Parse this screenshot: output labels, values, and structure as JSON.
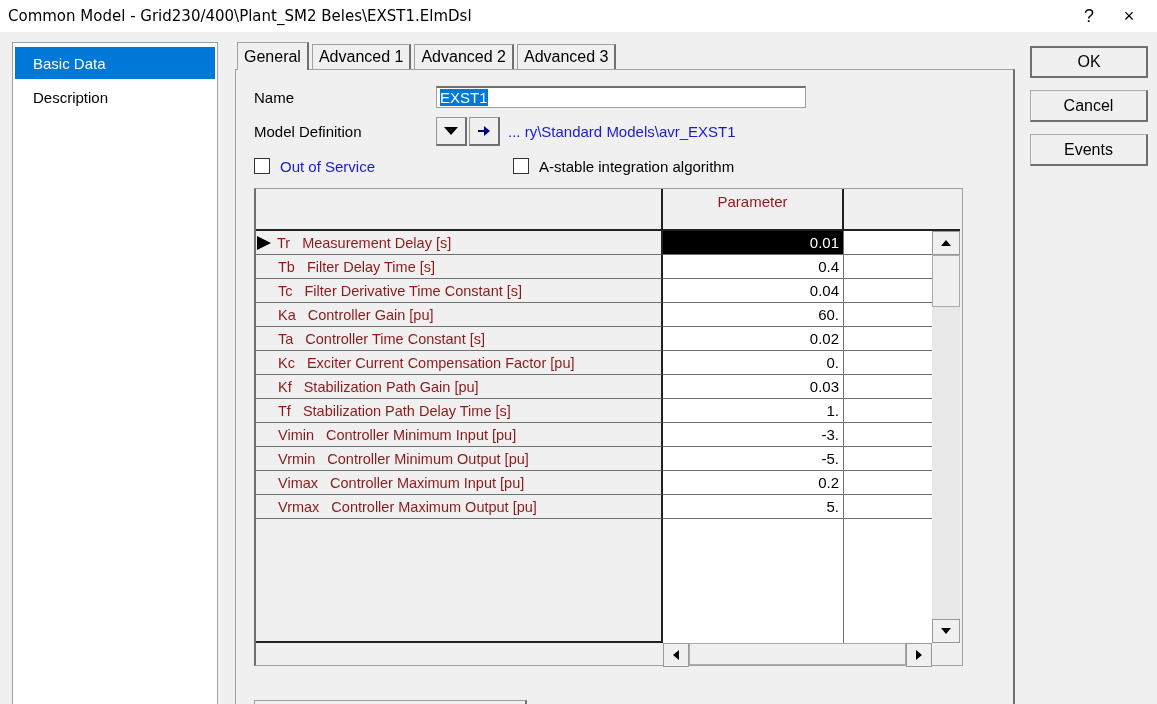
{
  "window": {
    "title": "Common Model - Grid230/400\\Plant_SM2 Beles\\EXST1.ElmDsl",
    "help": "?",
    "close": "×"
  },
  "sidebar": {
    "items": [
      {
        "label": "Basic Data",
        "selected": true
      },
      {
        "label": "Description",
        "selected": false
      }
    ]
  },
  "tabs": [
    {
      "label": "General",
      "selected": true
    },
    {
      "label": "Advanced 1",
      "selected": false
    },
    {
      "label": "Advanced 2",
      "selected": false
    },
    {
      "label": "Advanced 3",
      "selected": false
    }
  ],
  "form": {
    "name_label": "Name",
    "name_value": "EXST1",
    "model_definition_label": "Model Definition",
    "model_definition_link": "... ry\\Standard Models\\avr_EXST1",
    "checkboxes": [
      {
        "label": "Out of Service",
        "checked": false,
        "kind": "link"
      },
      {
        "label": "A-stable integration algorithm",
        "checked": false,
        "kind": "plain"
      }
    ]
  },
  "table": {
    "columns": [
      "Parameter"
    ],
    "rows": [
      {
        "symbol": "Tr",
        "description": "Measurement Delay [s]",
        "value": "0.01",
        "selected": true
      },
      {
        "symbol": "Tb",
        "description": "Filter Delay Time [s]",
        "value": "0.4",
        "selected": false
      },
      {
        "symbol": "Tc",
        "description": "Filter Derivative Time Constant [s]",
        "value": "0.04",
        "selected": false
      },
      {
        "symbol": "Ka",
        "description": "Controller Gain [pu]",
        "value": "60.",
        "selected": false
      },
      {
        "symbol": "Ta",
        "description": "Controller Time Constant [s]",
        "value": "0.02",
        "selected": false
      },
      {
        "symbol": "Kc",
        "description": "Exciter Current Compensation Factor [pu]",
        "value": "0.",
        "selected": false
      },
      {
        "symbol": "Kf",
        "description": "Stabilization Path Gain [pu]",
        "value": "0.03",
        "selected": false
      },
      {
        "symbol": "Tf",
        "description": "Stabilization Path Delay Time [s]",
        "value": "1.",
        "selected": false
      },
      {
        "symbol": "Vimin",
        "description": "Controller Minimum Input [pu]",
        "value": "-3.",
        "selected": false
      },
      {
        "symbol": "Vrmin",
        "description": "Controller Minimum Output [pu]",
        "value": "-5.",
        "selected": false
      },
      {
        "symbol": "Vimax",
        "description": "Controller Maximum Input [pu]",
        "value": "0.2",
        "selected": false
      },
      {
        "symbol": "Vrmax",
        "description": "Controller Maximum Output [pu]",
        "value": "5.",
        "selected": false
      }
    ]
  },
  "buttons": [
    "OK",
    "Cancel",
    "Events"
  ]
}
